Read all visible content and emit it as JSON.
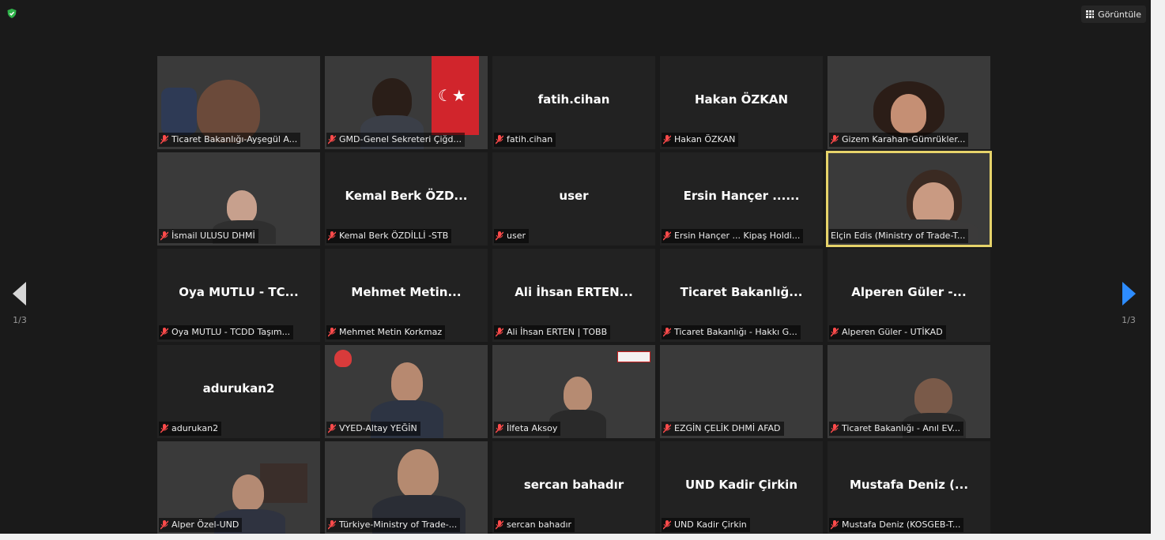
{
  "toolbar": {
    "view_label": "Görüntüle"
  },
  "pagination": {
    "left": "1/3",
    "right": "1/3"
  },
  "participants": [
    {
      "label": "Ticaret Bakanlığı-Ayşegül A..."
    },
    {
      "label": "GMD-Genel Sekreteri Çiğd..."
    },
    {
      "display": "fatih.cihan",
      "label": "fatih.cihan"
    },
    {
      "display": "Hakan ÖZKAN",
      "label": "Hakan ÖZKAN"
    },
    {
      "label": "Gizem Karahan-Gümrükler..."
    },
    {
      "label": "İsmail ULUSU DHMİ"
    },
    {
      "display": "Kemal Berk ÖZD...",
      "label": "Kemal Berk ÖZDİLLİ -STB"
    },
    {
      "display": "user",
      "label": "user"
    },
    {
      "display": "Ersin Hançer ......",
      "label": "Ersin Hançer ... Kipaş Holdi..."
    },
    {
      "label": "Elçin Edis (Ministry of Trade-T..."
    },
    {
      "display": "Oya MUTLU - TC...",
      "label": "Oya MUTLU - TCDD Taşım..."
    },
    {
      "display": "Mehmet Metin...",
      "label": "Mehmet Metin Korkmaz"
    },
    {
      "display": "Ali İhsan ERTEN...",
      "label": "Ali İhsan ERTEN | TOBB"
    },
    {
      "display": "Ticaret Bakanlığ...",
      "label": "Ticaret Bakanlığı - Hakkı G..."
    },
    {
      "display": "Alperen Güler -...",
      "label": "Alperen Güler - UTİKAD"
    },
    {
      "display": "adurukan2",
      "label": "adurukan2"
    },
    {
      "label": "VYED-Altay YEĞİN"
    },
    {
      "label": "İlfeta Aksoy"
    },
    {
      "label": "EZGİN ÇELİK DHMİ AFAD"
    },
    {
      "label": "Ticaret Bakanlığı - Anıl EV..."
    },
    {
      "label": "Alper Özel-UND"
    },
    {
      "label": "Türkiye-Ministry of Trade-..."
    },
    {
      "display": "sercan bahadır",
      "label": "sercan bahadır"
    },
    {
      "display": "UND Kadir Çirkin",
      "label": "UND Kadir Çirkin"
    },
    {
      "display": "Mustafa Deniz (...",
      "label": "Mustafa Deniz (KOSGEB-T..."
    }
  ]
}
